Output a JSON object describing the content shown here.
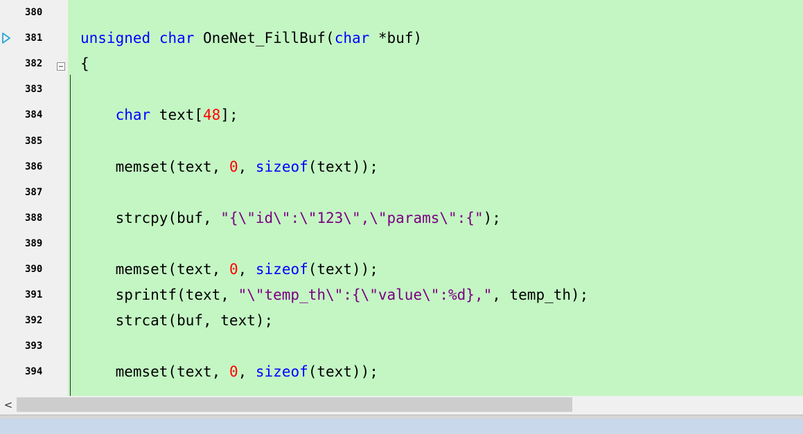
{
  "editor": {
    "lines": [
      {
        "num": "380",
        "tokens": []
      },
      {
        "num": "381",
        "tokens": [
          {
            "t": "unsigned",
            "c": "kw"
          },
          {
            "t": " "
          },
          {
            "t": "char",
            "c": "kw"
          },
          {
            "t": " OneNet_FillBuf("
          },
          {
            "t": "char",
            "c": "kw"
          },
          {
            "t": " *buf)"
          }
        ]
      },
      {
        "num": "382",
        "tokens": [
          {
            "t": "{"
          }
        ]
      },
      {
        "num": "383",
        "tokens": []
      },
      {
        "num": "384",
        "tokens": [
          {
            "t": "    "
          },
          {
            "t": "char",
            "c": "kw"
          },
          {
            "t": " text["
          },
          {
            "t": "48",
            "c": "num"
          },
          {
            "t": "];"
          }
        ]
      },
      {
        "num": "385",
        "tokens": []
      },
      {
        "num": "386",
        "tokens": [
          {
            "t": "    memset(text, "
          },
          {
            "t": "0",
            "c": "num"
          },
          {
            "t": ", "
          },
          {
            "t": "sizeof",
            "c": "kw"
          },
          {
            "t": "(text));"
          }
        ]
      },
      {
        "num": "387",
        "tokens": []
      },
      {
        "num": "388",
        "tokens": [
          {
            "t": "    strcpy(buf, "
          },
          {
            "t": "\"{\\\"id\\\":\\\"123\\\",\\\"params\\\":{\"",
            "c": "str"
          },
          {
            "t": ");"
          }
        ]
      },
      {
        "num": "389",
        "tokens": []
      },
      {
        "num": "390",
        "tokens": [
          {
            "t": "    memset(text, "
          },
          {
            "t": "0",
            "c": "num"
          },
          {
            "t": ", "
          },
          {
            "t": "sizeof",
            "c": "kw"
          },
          {
            "t": "(text));"
          }
        ]
      },
      {
        "num": "391",
        "tokens": [
          {
            "t": "    sprintf(text, "
          },
          {
            "t": "\"\\\"temp_th\\\":{\\\"value\\\":%d},\"",
            "c": "str"
          },
          {
            "t": ", temp_th);"
          }
        ]
      },
      {
        "num": "392",
        "tokens": [
          {
            "t": "    strcat(buf, text);"
          }
        ]
      },
      {
        "num": "393",
        "tokens": []
      },
      {
        "num": "394",
        "tokens": [
          {
            "t": "    memset(text, "
          },
          {
            "t": "0",
            "c": "num"
          },
          {
            "t": ", "
          },
          {
            "t": "sizeof",
            "c": "kw"
          },
          {
            "t": "(text));"
          }
        ]
      }
    ],
    "current_line": "381",
    "fold_line": "382"
  },
  "scrollbar": {
    "left_arrow": "<"
  },
  "colors": {
    "background": "#c4f6c4",
    "keyword": "#0000ff",
    "number": "#ff0000",
    "string": "#7a0080",
    "gutter": "#f0f0f0",
    "exec_arrow": "#2aa5d6"
  },
  "icons": {
    "exec_arrow": "current-line-arrow-icon",
    "fold_toggle": "fold-collapse-icon",
    "scroll_left": "scroll-left-arrow-icon"
  }
}
